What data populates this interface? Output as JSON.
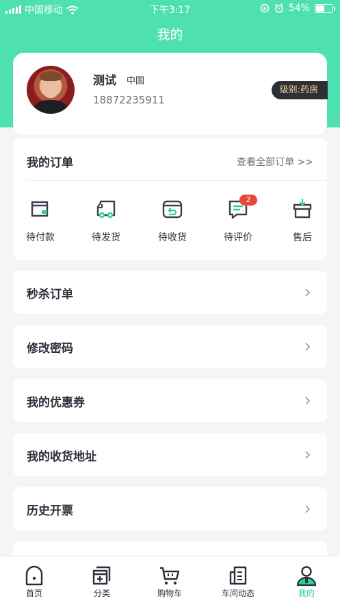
{
  "status_bar": {
    "carrier": "中国移动",
    "time": "下午3:17",
    "battery": "54%",
    "battery_level": 0.54
  },
  "nav": {
    "title": "我的"
  },
  "profile": {
    "name": "测试",
    "country": "中国",
    "phone": "18872235911",
    "level": "级别:药房"
  },
  "orders": {
    "title": "我的订单",
    "view_all": "查看全部订单 >>",
    "items": [
      {
        "label": "待付款",
        "icon": "wallet-icon"
      },
      {
        "label": "待发货",
        "icon": "truck-icon"
      },
      {
        "label": "待收货",
        "icon": "box-return-icon"
      },
      {
        "label": "待评价",
        "icon": "comment-icon",
        "badge": "2"
      },
      {
        "label": "售后",
        "icon": "gift-box-icon"
      }
    ]
  },
  "menu": [
    {
      "label": "秒杀订单"
    },
    {
      "label": "修改密码"
    },
    {
      "label": "我的优惠券"
    },
    {
      "label": "我的收货地址"
    },
    {
      "label": "历史开票"
    }
  ],
  "tabs": [
    {
      "label": "首页",
      "icon": "home-icon"
    },
    {
      "label": "分类",
      "icon": "category-icon"
    },
    {
      "label": "购物车",
      "icon": "cart-icon"
    },
    {
      "label": "车间动态",
      "icon": "news-icon"
    },
    {
      "label": "我的",
      "icon": "user-icon",
      "active": true
    }
  ],
  "colors": {
    "accent": "#4fe0b0",
    "active_tab": "#2bcf98",
    "badge": "#e8463a",
    "level_bg": "#2e2f35",
    "level_text": "#f3d7a0"
  }
}
